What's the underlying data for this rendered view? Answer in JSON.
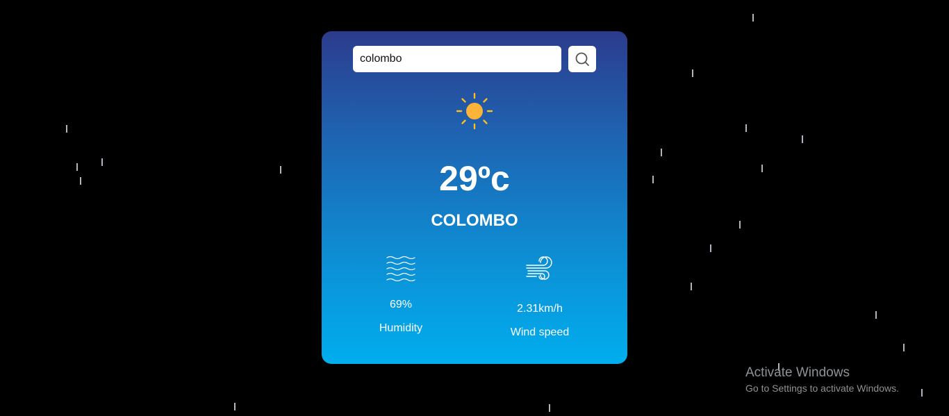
{
  "search": {
    "value": "colombo",
    "placeholder": ""
  },
  "weather": {
    "icon": "sun-icon",
    "temperature": "29ºc",
    "city": "COLOMBO"
  },
  "details": {
    "humidity": {
      "icon": "humidity-waves-icon",
      "value": "69%",
      "label": "Humidity"
    },
    "wind": {
      "icon": "wind-icon",
      "value": "2.31km/h",
      "label": "Wind speed"
    }
  },
  "watermark": {
    "title": "Activate Windows",
    "subtitle": "Go to Settings to activate Windows."
  },
  "colors": {
    "background": "#000000",
    "card_top": "#2c3b8c",
    "card_bottom": "#00aeee",
    "sun": "#fbbf36",
    "text": "#ffffff"
  }
}
